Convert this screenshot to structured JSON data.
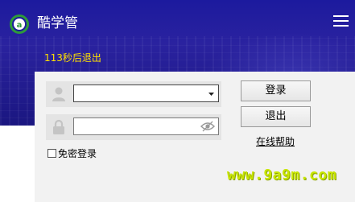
{
  "app": {
    "title": "酷学管"
  },
  "header": {
    "countdown": "113秒后退出"
  },
  "login": {
    "username": {
      "value": "",
      "icon": "user-icon"
    },
    "password": {
      "value": "",
      "icon": "lock-icon"
    },
    "remember_label": "免密登录",
    "remember_checked": false,
    "login_button": "登录",
    "exit_button": "退出",
    "help_link": "在线帮助"
  },
  "watermark": "www.9a9m.com",
  "colors": {
    "banner": "#1c1a9e",
    "countdown": "#ffe000",
    "logo_green": "#2e9a3a",
    "watermark": "#c8e600"
  }
}
